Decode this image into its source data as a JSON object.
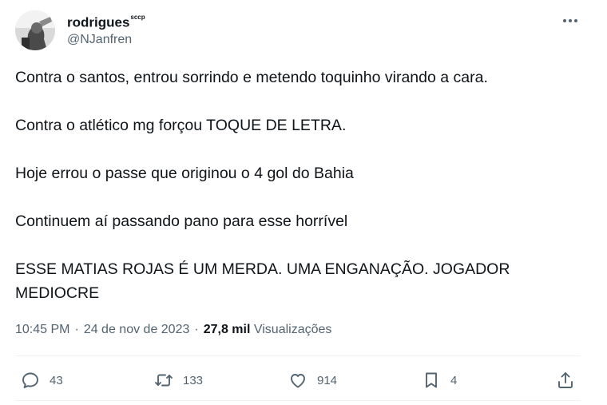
{
  "author": {
    "display_name": "rodrigues",
    "name_superscript": "sccp",
    "handle": "@NJanfren"
  },
  "tweet": {
    "paragraphs": [
      "Contra o santos, entrou sorrindo e metendo toquinho virando a cara.",
      "Contra o atlético mg forçou TOQUE DE LETRA.",
      "Hoje errou o passe que originou o 4 gol do Bahia",
      "Continuem aí passando pano para esse horrível",
      "ESSE MATIAS ROJAS É UM MERDA. UMA ENGANAÇÃO. JOGADOR\nMEDIOCRE"
    ]
  },
  "meta": {
    "time": "10:45 PM",
    "separator": "·",
    "date": "24 de nov de 2023",
    "views_count": "27,8 mil",
    "views_label": "Visualizações"
  },
  "actions": {
    "replies": "43",
    "retweets": "133",
    "likes": "914",
    "bookmarks": "4"
  },
  "icons": {
    "more": "more-dots-icon",
    "reply": "reply-icon",
    "retweet": "retweet-icon",
    "like": "heart-icon",
    "bookmark": "bookmark-icon",
    "share": "share-icon"
  },
  "colors": {
    "text": "#0f1419",
    "secondary": "#536471",
    "divider": "#eff3f4"
  }
}
